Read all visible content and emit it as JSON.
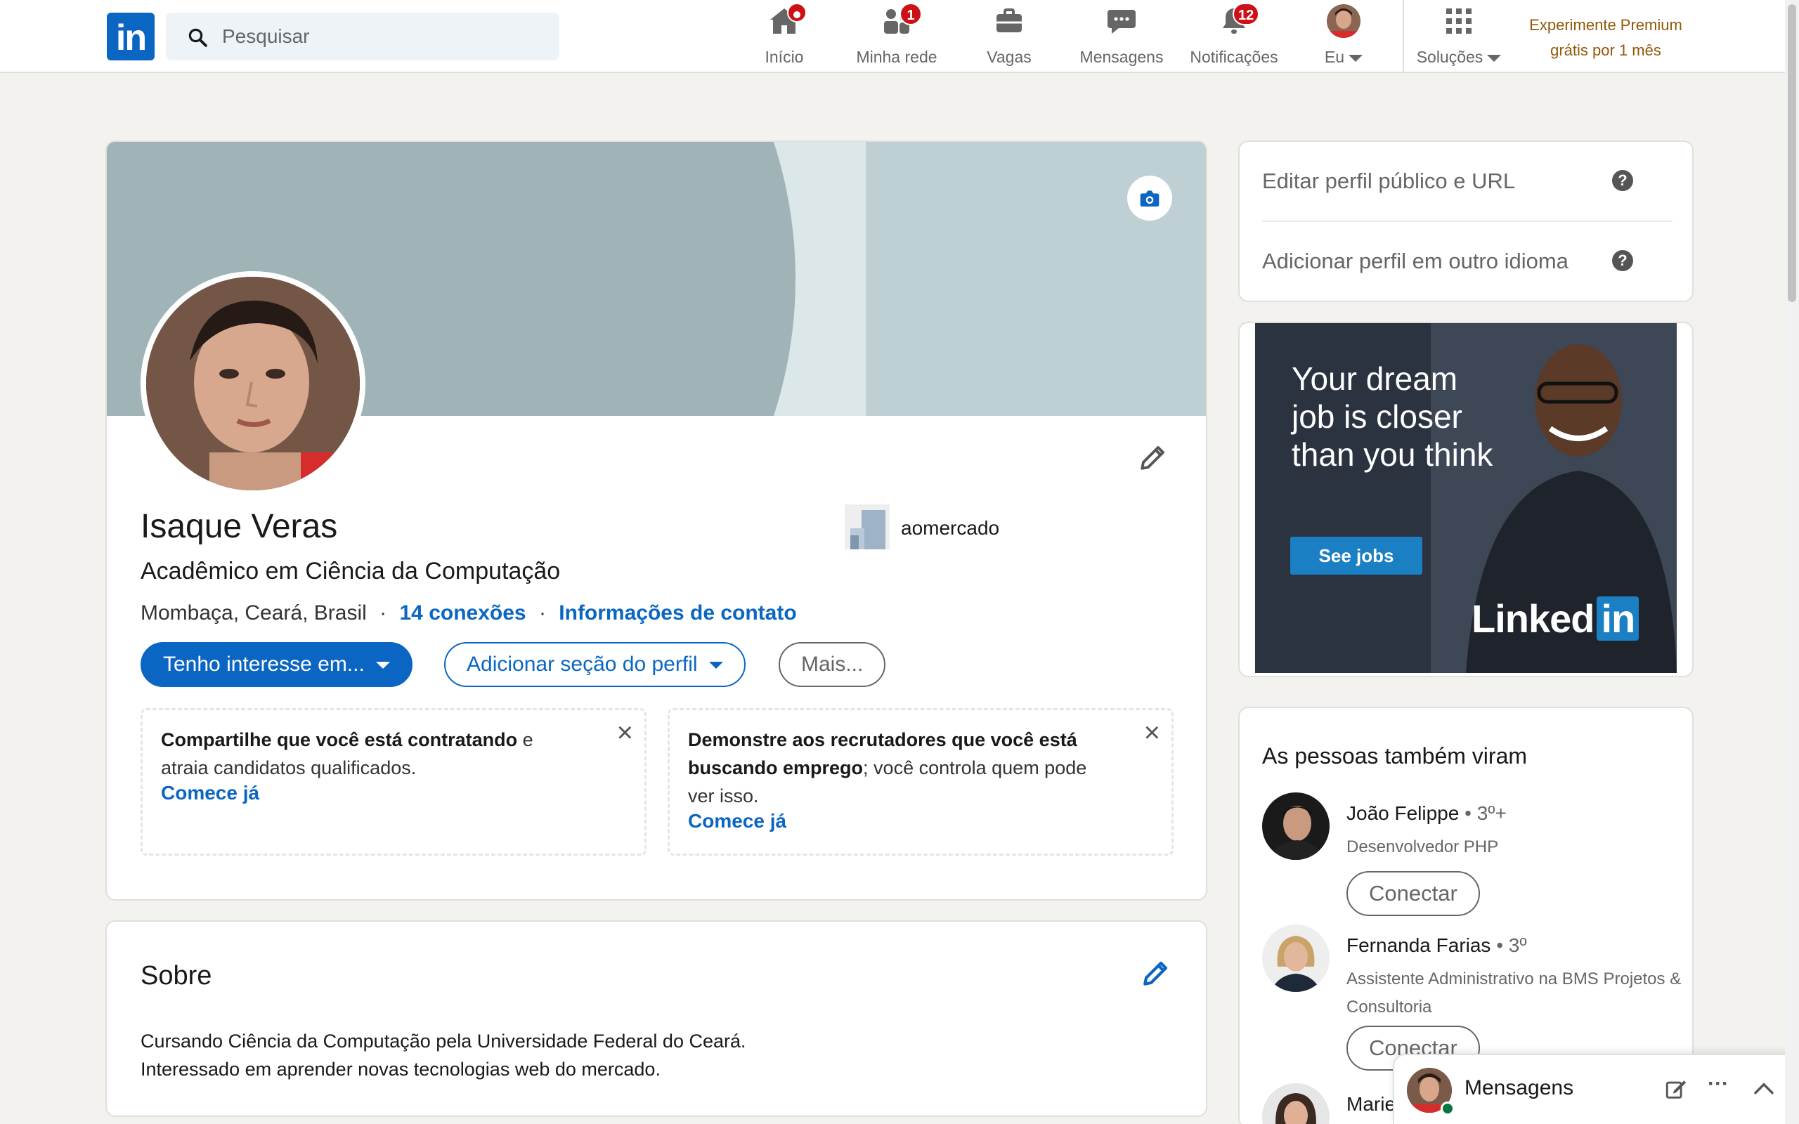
{
  "search": {
    "placeholder": "Pesquisar"
  },
  "nav": {
    "home": "Início",
    "network": "Minha rede",
    "network_badge": "1",
    "jobs": "Vagas",
    "messages": "Mensagens",
    "notifications": "Notificações",
    "notifications_badge": "12",
    "me": "Eu",
    "solutions": "Soluções",
    "premium_line1": "Experimente Premium",
    "premium_line2": "grátis por 1 mês"
  },
  "profile": {
    "name": "Isaque Veras",
    "headline": "Acadêmico em Ciência da Computação",
    "location": "Mombaça, Ceará, Brasil",
    "sep": "·",
    "connections": "14 conexões",
    "contact_info": "Informações de contato",
    "company": "aomercado",
    "btn_interest": "Tenho interesse em...",
    "btn_add_section": "Adicionar seção do perfil",
    "btn_more": "Mais..."
  },
  "promos": [
    {
      "bold": "Compartilhe que você está contratando",
      "rest": " e atraia candidatos qualificados.",
      "cta": "Comece já"
    },
    {
      "bold": "Demonstre aos recrutadores que você está buscando emprego",
      "rest": "; você controla quem pode ver isso.",
      "cta": "Comece já"
    }
  ],
  "about": {
    "title": "Sobre",
    "line1": "Cursando Ciência da Computação pela Universidade Federal do Ceará.",
    "line2": "Interessado em aprender novas tecnologias web do mercado."
  },
  "sidebar": {
    "edit_public": "Editar perfil público e URL",
    "add_language": "Adicionar perfil em outro idioma",
    "qmark": "?"
  },
  "ad": {
    "text": "Your dream job is closer than you think",
    "cta": "See jobs",
    "brand_a": "Linked",
    "brand_b": "in"
  },
  "also_viewed": {
    "title": "As pessoas também viram",
    "people": [
      {
        "name": "João Felippe",
        "degree": " • 3º+",
        "title": "Desenvolvedor PHP",
        "action": "Conectar"
      },
      {
        "name": "Fernanda Farias",
        "degree": " • 3º",
        "title": "Assistente Administrativo na BMS Projetos & Consultoria",
        "action": "Conectar"
      },
      {
        "name": "Marie",
        "degree": "",
        "title": "",
        "action": ""
      }
    ]
  },
  "messaging": {
    "label": "Mensagens",
    "dots": "···"
  },
  "colors": {
    "brand": "#0a66c2",
    "badge": "#cc1016",
    "premium": "#915907"
  }
}
